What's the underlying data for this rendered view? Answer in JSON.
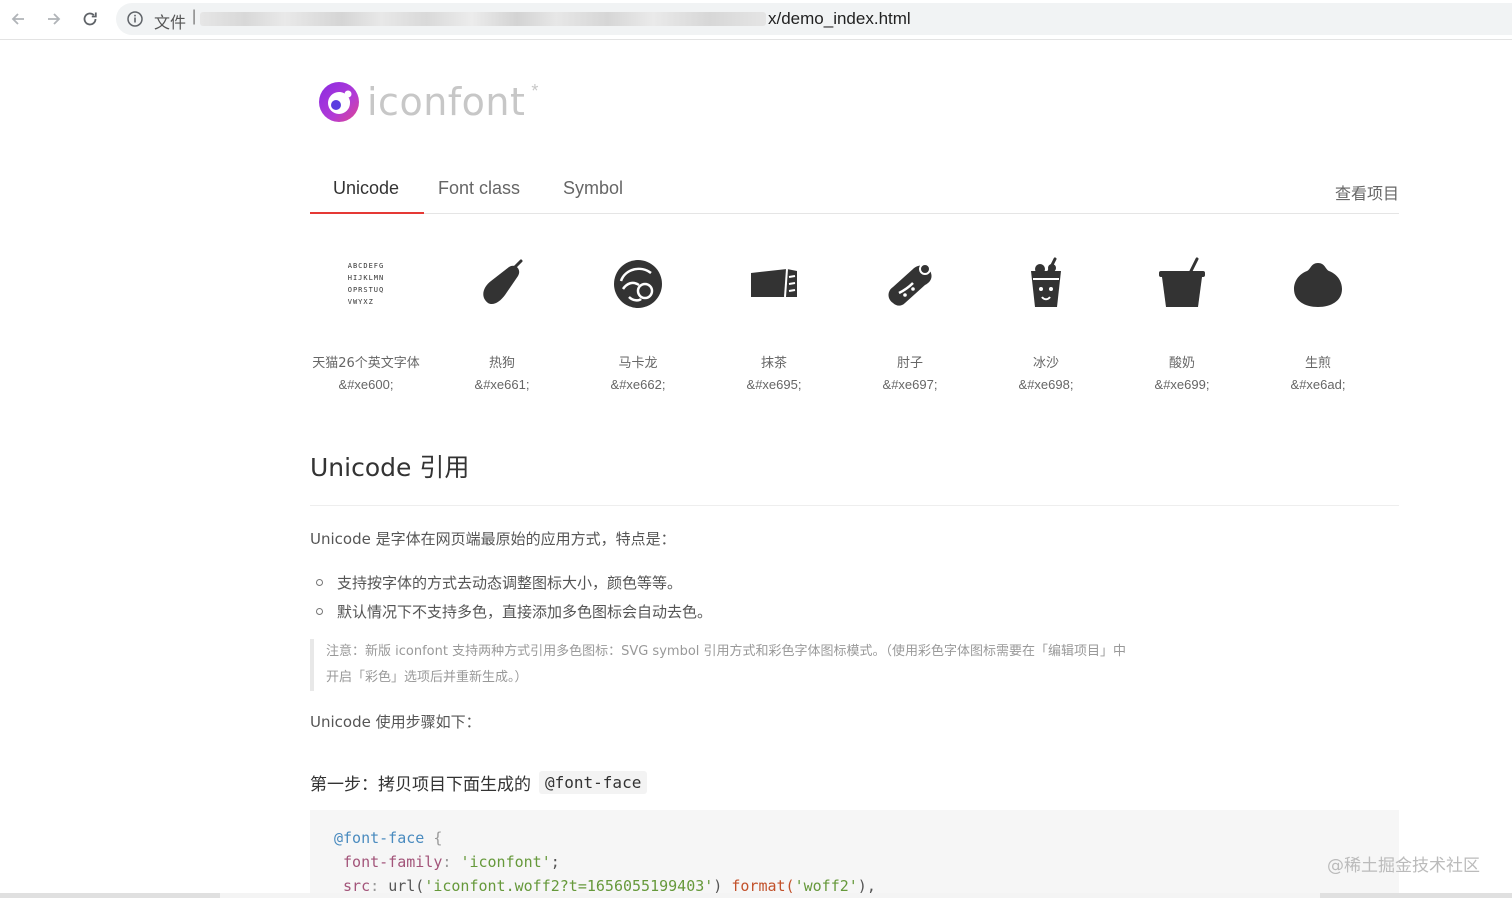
{
  "browser": {
    "file_label": "文件",
    "separator": "|",
    "url_tail": "x/demo_index.html"
  },
  "logo": {
    "text": "iconfont",
    "star": "*"
  },
  "tabs": [
    {
      "label": "Unicode",
      "active": true
    },
    {
      "label": "Font class",
      "active": false
    },
    {
      "label": "Symbol",
      "active": false
    }
  ],
  "view_project": "查看项目",
  "icons": [
    {
      "name": "天猫26个英文字体",
      "code": "&#xe600;",
      "icon": "alphabet-icon"
    },
    {
      "name": "热狗",
      "code": "&#xe661;",
      "icon": "hotdog-icon"
    },
    {
      "name": "马卡龙",
      "code": "&#xe662;",
      "icon": "macaron-icon"
    },
    {
      "name": "抹茶",
      "code": "&#xe695;",
      "icon": "matcha-icon"
    },
    {
      "name": "肘子",
      "code": "&#xe697;",
      "icon": "pork-knuckle-icon"
    },
    {
      "name": "冰沙",
      "code": "&#xe698;",
      "icon": "smoothie-icon"
    },
    {
      "name": "酸奶",
      "code": "&#xe699;",
      "icon": "yogurt-icon"
    },
    {
      "name": "生煎",
      "code": "&#xe6ad;",
      "icon": "bun-icon"
    }
  ],
  "alphabet_lines": [
    "ABCDEFG",
    "HIJKLMN",
    "OPRSTUQ",
    "VWYXZ"
  ],
  "content": {
    "heading": "Unicode 引用",
    "intro": "Unicode 是字体在网页端最原始的应用方式，特点是：",
    "bullets": [
      "支持按字体的方式去动态调整图标大小，颜色等等。",
      "默认情况下不支持多色，直接添加多色图标会自动去色。"
    ],
    "note_line1": "注意：新版 iconfont 支持两种方式引用多色图标：SVG symbol 引用方式和彩色字体图标模式。（使用彩色字体图标需要在「编辑项目」中",
    "note_line2": "开启「彩色」选项后并重新生成。）",
    "steps_intro": "Unicode 使用步骤如下：",
    "step1_text": "第一步：拷贝项目下面生成的",
    "step1_code": "@font-face"
  },
  "code": {
    "line1_at": "@font-face",
    "line1_brace": " {",
    "line2_prop": "font-family",
    "line2_colon": ": ",
    "line2_val": "'iconfont'",
    "line2_end": ";",
    "line3_prop": "src",
    "line3_colon": ": ",
    "line3_fn": "url(",
    "line3_val": "'iconfont.woff2?t=1656055199403'",
    "line3_close": ") ",
    "line3_fmt": "format(",
    "line3_fmtval": "'woff2'",
    "line3_end": "),"
  },
  "watermark": "@稀土掘金技术社区"
}
